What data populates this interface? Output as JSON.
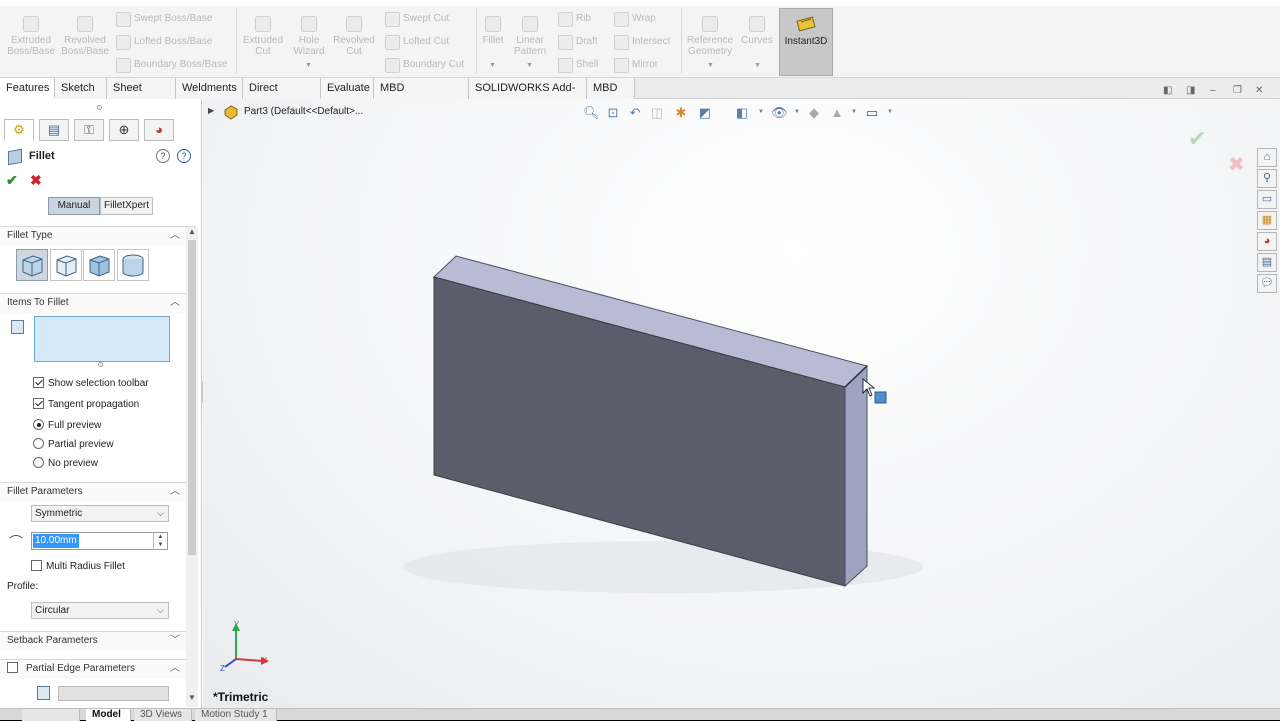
{
  "ribbon": {
    "extruded_boss": "Extruded\nBoss/Base",
    "revolved_boss": "Revolved\nBoss/Base",
    "swept_boss": "Swept Boss/Base",
    "lofted_boss": "Lofted Boss/Base",
    "boundary_boss": "Boundary Boss/Base",
    "extruded_cut": "Extruded\nCut",
    "hole_wizard": "Hole\nWizard",
    "revolved_cut": "Revolved\nCut",
    "swept_cut": "Swept Cut",
    "lofted_cut": "Lofted Cut",
    "boundary_cut": "Boundary Cut",
    "fillet": "Fillet",
    "linear_pattern": "Linear\nPattern",
    "rib": "Rib",
    "draft": "Draft",
    "shell": "Shell",
    "wrap": "Wrap",
    "intersect": "Intersect",
    "mirror": "Mirror",
    "reference_geometry": "Reference\nGeometry",
    "curves": "Curves",
    "instant3d": "Instant3D"
  },
  "tabs": [
    "Features",
    "Sketch",
    "Sheet Metal",
    "Weldments",
    "Direct Editing",
    "Evaluate",
    "MBD Dimensions",
    "SOLIDWORKS Add-Ins",
    "MBD"
  ],
  "panel": {
    "title": "Fillet",
    "mode_manual": "Manual",
    "mode_filletxpert": "FilletXpert",
    "fillet_type_header": "Fillet Type",
    "items_header": "Items To Fillet",
    "show_selection_toolbar": "Show selection toolbar",
    "tangent_propagation": "Tangent propagation",
    "full_preview": "Full preview",
    "partial_preview": "Partial preview",
    "no_preview": "No preview",
    "fillet_params_header": "Fillet Parameters",
    "symmetric": "Symmetric",
    "radius_value": "10.00mm",
    "multi_radius": "Multi Radius Fillet",
    "profile_label": "Profile:",
    "profile_value": "Circular",
    "setback_header": "Setback Parameters",
    "partial_edge_header": "Partial Edge Parameters"
  },
  "viewport": {
    "tree_label": "Part3  (Default<<Default>...",
    "view_name": "*Trimetric"
  },
  "bottom_tabs": [
    "",
    "Model",
    "3D Views",
    "Motion Study 1"
  ]
}
